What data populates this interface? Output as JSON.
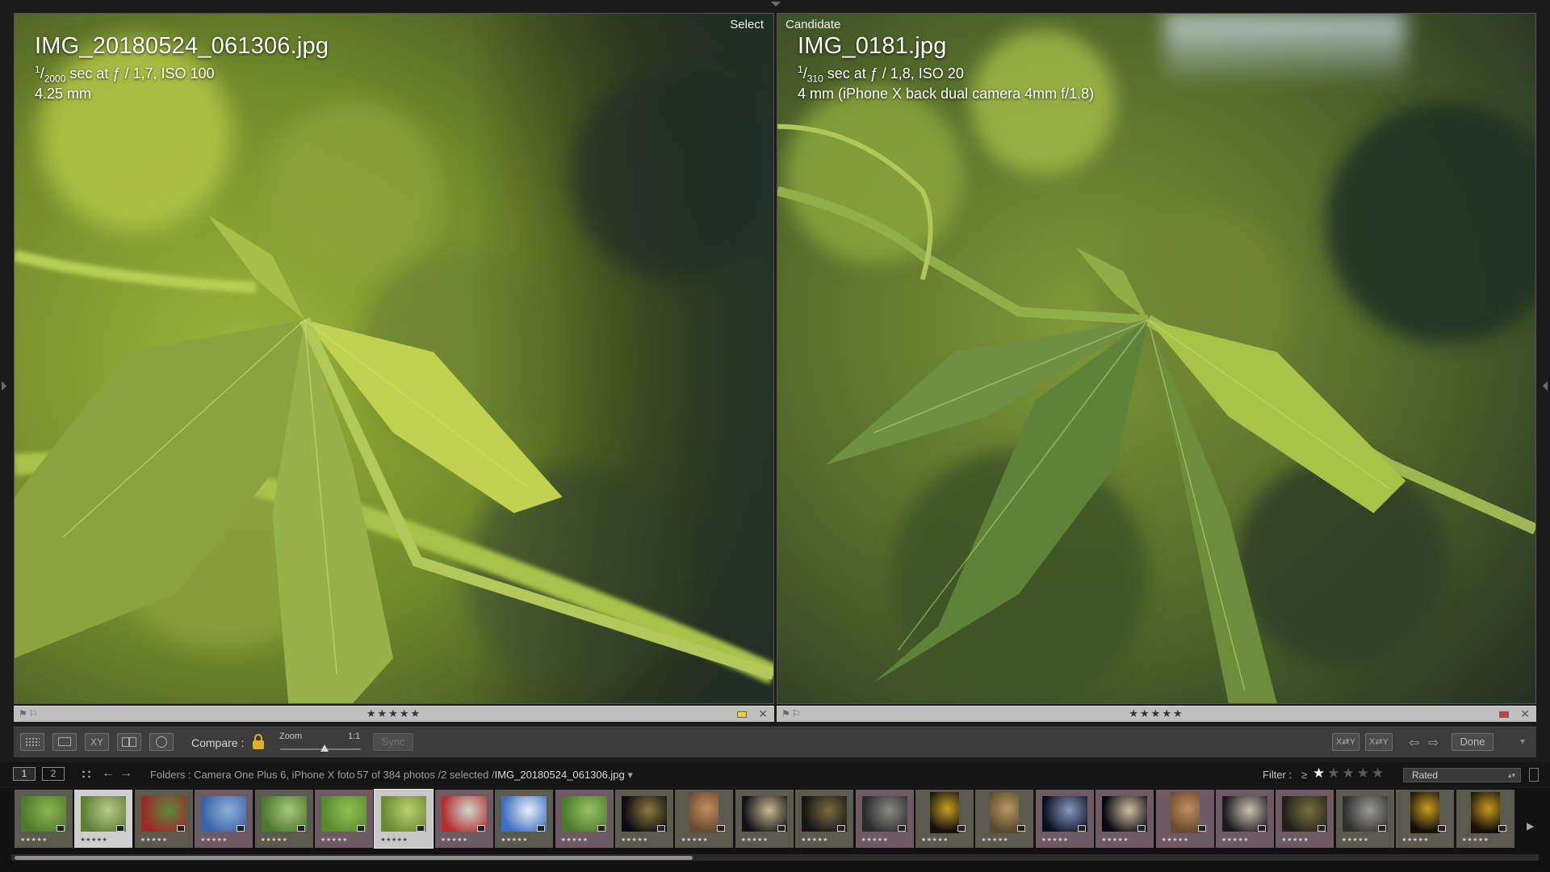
{
  "select_pane": {
    "tag": "Select",
    "filename": "IMG_20180524_061306.jpg",
    "shutter_num": "1",
    "shutter_den": "2000",
    "exposure_rest": " sec at ƒ / 1,7, ISO 100",
    "lens": "4.25 mm",
    "rating_stars": "★★★★★",
    "color_label": "#e8d22a"
  },
  "candidate_pane": {
    "tag": "Candidate",
    "filename": "IMG_0181.jpg",
    "shutter_num": "1",
    "shutter_den": "310",
    "exposure_rest": " sec at ƒ / 1,8, ISO 20",
    "lens": "4 mm (iPhone X back dual camera 4mm f/1.8)",
    "rating_stars": "★★★★★",
    "color_label": "#e0383a"
  },
  "pane_bar": {
    "flag_icons": "⚑⚐",
    "close_glyph": "✕"
  },
  "toolbar": {
    "compare_xy_label": "XY",
    "compare_label": "Compare :",
    "zoom_label": "Zoom",
    "zoom_ratio": "1:1",
    "sync_label": "Sync",
    "swap_label": "X⇄Y",
    "make_select_label": "X⇄Y",
    "prev_glyph": "⇦",
    "next_glyph": "⇨",
    "done_label": "Done",
    "chevron": "▾"
  },
  "statusbar": {
    "page1": "1",
    "page2": "2",
    "back_glyph": "←",
    "fwd_glyph": "→",
    "folder_text": "Folders : Camera One Plus 6, iPhone X foto",
    "count_text": "57 of 384 photos /2 selected /",
    "selected_file": "IMG_20180524_061306.jpg",
    "dropdown_glyph": " ▾",
    "filter_label": "Filter :",
    "filter_ge": "≥",
    "filter_stars_on": "★",
    "filter_stars_off": "★★★★",
    "filter_value": "Rated",
    "filter_arrows": "▴▾"
  },
  "filmstrip": {
    "thumb_stars": "★★★★★"
  },
  "colors": {
    "accent_lock": "#e0b020",
    "background": "#1b1b1b"
  }
}
